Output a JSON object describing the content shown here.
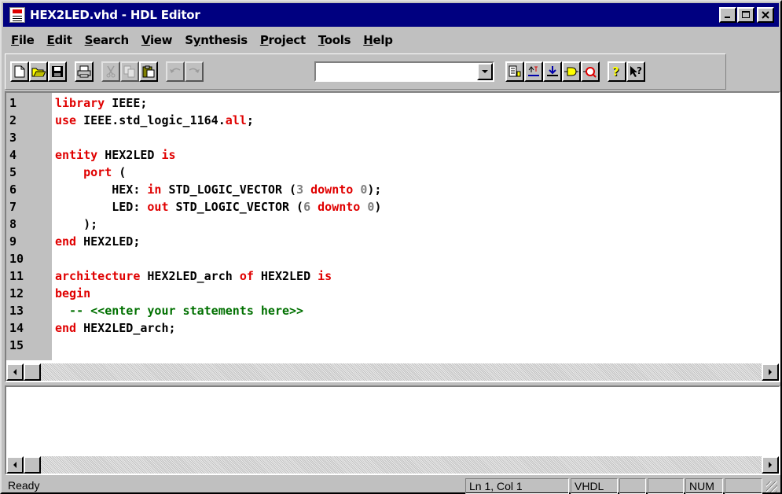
{
  "window": {
    "title": "HEX2LED.vhd - HDL Editor",
    "controls": [
      "minimize",
      "maximize",
      "close"
    ]
  },
  "menu": [
    {
      "label": "File",
      "underline": "F"
    },
    {
      "label": "Edit",
      "underline": "E"
    },
    {
      "label": "Search",
      "underline": "S"
    },
    {
      "label": "View",
      "underline": "V"
    },
    {
      "label": "Synthesis",
      "underline": "y"
    },
    {
      "label": "Project",
      "underline": "P"
    },
    {
      "label": "Tools",
      "underline": "T"
    },
    {
      "label": "Help",
      "underline": "H"
    }
  ],
  "toolbar": {
    "buttons": [
      {
        "name": "new-file-icon",
        "enabled": true
      },
      {
        "name": "open-folder-icon",
        "enabled": true
      },
      {
        "name": "save-icon",
        "enabled": true
      },
      {
        "name": "print-icon",
        "enabled": true
      },
      {
        "name": "cut-icon",
        "enabled": false
      },
      {
        "name": "copy-icon",
        "enabled": false
      },
      {
        "name": "paste-icon",
        "enabled": true
      },
      {
        "name": "undo-icon",
        "enabled": false
      },
      {
        "name": "redo-icon",
        "enabled": false
      },
      {
        "name": "language-assistant-icon",
        "enabled": true
      },
      {
        "name": "check-syntax-icon",
        "enabled": true
      },
      {
        "name": "synthesize-icon",
        "enabled": true
      },
      {
        "name": "create-macro-icon",
        "enabled": true
      },
      {
        "name": "find-in-design-icon",
        "enabled": true
      },
      {
        "name": "help-icon",
        "enabled": true
      },
      {
        "name": "context-help-icon",
        "enabled": true
      }
    ],
    "combo_value": ""
  },
  "editor": {
    "lines": [
      {
        "n": "1",
        "tokens": [
          [
            "kw",
            "library"
          ],
          [
            "id",
            " IEEE;"
          ]
        ]
      },
      {
        "n": "2",
        "tokens": [
          [
            "kw",
            "use"
          ],
          [
            "id",
            " IEEE.std_logic_1164."
          ],
          [
            "kw",
            "all"
          ],
          [
            "id",
            ";"
          ]
        ]
      },
      {
        "n": "3",
        "tokens": []
      },
      {
        "n": "4",
        "tokens": [
          [
            "kw",
            "entity"
          ],
          [
            "id",
            " HEX2LED "
          ],
          [
            "kw",
            "is"
          ]
        ]
      },
      {
        "n": "5",
        "tokens": [
          [
            "id",
            "    "
          ],
          [
            "kw",
            "port"
          ],
          [
            "id",
            " ("
          ]
        ]
      },
      {
        "n": "6",
        "tokens": [
          [
            "id",
            "        HEX: "
          ],
          [
            "kw",
            "in"
          ],
          [
            "id",
            " STD_LOGIC_VECTOR ("
          ],
          [
            "num",
            "3"
          ],
          [
            "id",
            " "
          ],
          [
            "kw",
            "downto"
          ],
          [
            "id",
            " "
          ],
          [
            "num",
            "0"
          ],
          [
            "id",
            ");"
          ]
        ]
      },
      {
        "n": "7",
        "tokens": [
          [
            "id",
            "        LED: "
          ],
          [
            "kw",
            "out"
          ],
          [
            "id",
            " STD_LOGIC_VECTOR ("
          ],
          [
            "num",
            "6"
          ],
          [
            "id",
            " "
          ],
          [
            "kw",
            "downto"
          ],
          [
            "id",
            " "
          ],
          [
            "num",
            "0"
          ],
          [
            "id",
            ")"
          ]
        ]
      },
      {
        "n": "8",
        "tokens": [
          [
            "id",
            "    );"
          ]
        ]
      },
      {
        "n": "9",
        "tokens": [
          [
            "kw",
            "end"
          ],
          [
            "id",
            " HEX2LED;"
          ]
        ]
      },
      {
        "n": "10",
        "tokens": []
      },
      {
        "n": "11",
        "tokens": [
          [
            "kw",
            "architecture"
          ],
          [
            "id",
            " HEX2LED_arch "
          ],
          [
            "kw",
            "of"
          ],
          [
            "id",
            " HEX2LED "
          ],
          [
            "kw",
            "is"
          ]
        ]
      },
      {
        "n": "12",
        "tokens": [
          [
            "kw",
            "begin"
          ]
        ]
      },
      {
        "n": "13",
        "tokens": [
          [
            "cm",
            "  -- <<enter your statements here>>"
          ]
        ]
      },
      {
        "n": "14",
        "tokens": [
          [
            "kw",
            "end"
          ],
          [
            "id",
            " HEX2LED_arch;"
          ]
        ]
      },
      {
        "n": "15",
        "tokens": []
      }
    ]
  },
  "status": {
    "ready": "Ready",
    "position": "Ln 1, Col 1",
    "language": "VHDL",
    "panel3": "",
    "panel4": "",
    "num": "NUM",
    "panel6": ""
  },
  "colors": {
    "titlebar": "#000080",
    "keyword": "#e00000",
    "comment": "#007000",
    "number": "#808080",
    "face": "#c0c0c0"
  }
}
